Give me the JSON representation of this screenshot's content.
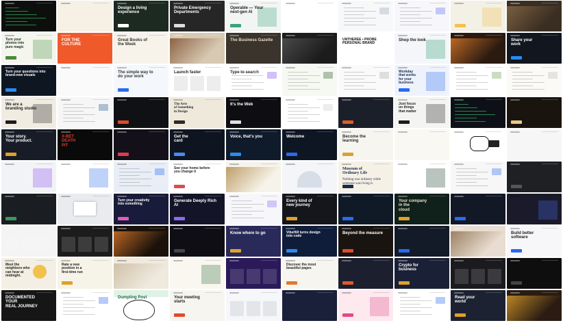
{
  "tiles": [
    {
      "bg": "#0d0f0d",
      "fg": "#3bd16f",
      "t": "",
      "s": "",
      "accent": "#3bd16f",
      "kind": "terminal"
    },
    {
      "bg": "#f6f1e4",
      "fg": "#c49a3a",
      "t": "",
      "s": "",
      "accent": "#d6b46a",
      "kind": "text"
    },
    {
      "bg": "#1c2a22",
      "fg": "#ffffff",
      "t": "Design a living\nexperience",
      "s": "",
      "accent": "#ffffff",
      "kind": "hero"
    },
    {
      "bg": "#262626",
      "fg": "#ffffff",
      "t": "Private Emergency\nDepartments",
      "s": "",
      "accent": "#dddddd",
      "kind": "hero"
    },
    {
      "bg": "#f3f5f4",
      "fg": "#222222",
      "t": "Operable — Your\nnext-gen AI",
      "s": "",
      "accent": "#3aa47a",
      "kind": "split"
    },
    {
      "bg": "#ffffff",
      "fg": "#333333",
      "t": "",
      "s": "",
      "accent": "#e7a8c4",
      "kind": "blobs"
    },
    {
      "bg": "#f7f8fa",
      "fg": "#333333",
      "t": "",
      "s": "",
      "accent": "#9aa3b2",
      "kind": "doc"
    },
    {
      "bg": "#f7f7fb",
      "fg": "#333333",
      "t": "",
      "s": "",
      "accent": "#5b6cf6",
      "kind": "doc"
    },
    {
      "bg": "#f3f0e6",
      "fg": "#222222",
      "t": "",
      "s": "",
      "accent": "#f2c14a",
      "kind": "split"
    },
    {
      "bg": "#3a2e22",
      "fg": "#ffffff",
      "t": "",
      "s": "",
      "accent": "#8a6b4a",
      "kind": "photo"
    },
    {
      "bg": "#f4f6ee",
      "fg": "#1d2a1d",
      "t": "Turn your\nphotos into\npure magic",
      "s": "",
      "accent": "#4a8a3a",
      "kind": "split"
    },
    {
      "bg": "#f05a2a",
      "fg": "#ffffff",
      "t": "FOR THE\nCULTURE",
      "s": "",
      "accent": "#1c1c7a",
      "kind": "poster"
    },
    {
      "bg": "#f7f3ea",
      "fg": "#333333",
      "t": "Great Books of\nthe Week",
      "s": "",
      "accent": "#c47a3a",
      "kind": "text"
    },
    {
      "bg": "#d8c9b2",
      "fg": "#ffffff",
      "t": "",
      "s": "",
      "accent": "#7a4a2a",
      "kind": "photo"
    },
    {
      "bg": "#3a342c",
      "fg": "#e8dcc8",
      "t": "The Business Gazette",
      "s": "",
      "accent": "#e8dcc8",
      "kind": "news"
    },
    {
      "bg": "#1c1c1c",
      "fg": "#eeeeee",
      "t": "",
      "s": "",
      "accent": "#555555",
      "kind": "photo"
    },
    {
      "bg": "#ffffff",
      "fg": "#111111",
      "t": "UNTHEREE • PROBE\nPERSONAL BRAND",
      "s": "",
      "accent": "#111111",
      "kind": "bold"
    },
    {
      "bg": "#f4f6fa",
      "fg": "#222222",
      "t": "Shop the look",
      "s": "",
      "accent": "#2a9a6a",
      "kind": "phone"
    },
    {
      "bg": "#2a1a10",
      "fg": "#ffffff",
      "t": "",
      "s": "",
      "accent": "#e07a2a",
      "kind": "food"
    },
    {
      "bg": "#11161f",
      "fg": "#ffffff",
      "t": "Share your\nwork",
      "s": "",
      "accent": "#2a8af0",
      "kind": "hero"
    },
    {
      "bg": "#0e1622",
      "fg": "#ffffff",
      "t": "Turn your questions into\nbrand-new visuals",
      "s": "",
      "accent": "#2a8af0",
      "kind": "hero"
    },
    {
      "bg": "#fafafa",
      "fg": "#333333",
      "t": "",
      "s": "",
      "accent": "#dddddd",
      "kind": "blank"
    },
    {
      "bg": "#f4f7fb",
      "fg": "#333333",
      "t": "The simple way to\ndo your work",
      "s": "",
      "accent": "#2a6af0",
      "kind": "hero-light"
    },
    {
      "bg": "#ffffff",
      "fg": "#222222",
      "t": "Launch faster",
      "s": "",
      "accent": "#c04a9a",
      "kind": "cards"
    },
    {
      "bg": "#ffffff",
      "fg": "#333333",
      "t": "Type to search",
      "s": "",
      "accent": "#7a4af0",
      "kind": "grid-light"
    },
    {
      "bg": "#f6f8f2",
      "fg": "#2a3a2a",
      "t": "",
      "s": "",
      "accent": "#2a5a2a",
      "kind": "doc"
    },
    {
      "bg": "#fafafa",
      "fg": "#333333",
      "t": "",
      "s": "",
      "accent": "#aaaaaa",
      "kind": "doc"
    },
    {
      "bg": "#eef3fb",
      "fg": "#1a2a4a",
      "t": "Workday\nthat works\nfor your\nbusiness",
      "s": "",
      "accent": "#2a6af0",
      "kind": "split"
    },
    {
      "bg": "#ffffff",
      "fg": "#333333",
      "t": "",
      "s": "",
      "accent": "#6a9a4a",
      "kind": "doc"
    },
    {
      "bg": "#fbfaf6",
      "fg": "#333333",
      "t": "",
      "s": "",
      "accent": "#bbbbbb",
      "kind": "doc"
    },
    {
      "bg": "#f0ece2",
      "fg": "#222222",
      "t": "We are a\nbranding studio",
      "s": "",
      "accent": "#1c1c1c",
      "kind": "split"
    },
    {
      "bg": "#f6f6f6",
      "fg": "#333333",
      "t": "",
      "s": "",
      "accent": "#2a5a8a",
      "kind": "book"
    },
    {
      "bg": "#0f1115",
      "fg": "#ffffff",
      "t": "",
      "s": "",
      "accent": "#e04a2a",
      "kind": "dark"
    },
    {
      "bg": "#efe9dc",
      "fg": "#2a2a2a",
      "t": "The Arte\nof Something\nin Design",
      "s": "",
      "accent": "#2a2a2a",
      "kind": "serif"
    },
    {
      "bg": "#0d0d12",
      "fg": "#ffffff",
      "t": "It's the Web",
      "s": "",
      "accent": "#e0e0e0",
      "kind": "hero"
    },
    {
      "bg": "#ffffff",
      "fg": "#333333",
      "t": "",
      "s": "",
      "accent": "#cccccc",
      "kind": "flow"
    },
    {
      "bg": "#1b1f2a",
      "fg": "#ffffff",
      "t": "",
      "s": "",
      "accent": "#e05a2a",
      "kind": "dark"
    },
    {
      "bg": "#f4f4f2",
      "fg": "#222222",
      "t": "Just focus\non things\nthat matter",
      "s": "",
      "accent": "#1c1c1c",
      "kind": "split"
    },
    {
      "bg": "#0d1117",
      "fg": "#3bd16f",
      "t": "",
      "s": "",
      "accent": "#3bd16f",
      "kind": "terminal"
    },
    {
      "bg": "#1a140e",
      "fg": "#e8c88a",
      "t": "",
      "s": "",
      "accent": "#e8c88a",
      "kind": "dark"
    },
    {
      "bg": "#171c26",
      "fg": "#ffffff",
      "t": "Your story.\nYour product.",
      "s": "",
      "accent": "#e0a02a",
      "kind": "hero"
    },
    {
      "bg": "#0a0a0a",
      "fg": "#e03a2a",
      "t": "X-BET\nDEATH\nPIT",
      "s": "",
      "accent": "#e03a2a",
      "kind": "bold"
    },
    {
      "bg": "#14101a",
      "fg": "#e0e0e0",
      "t": "",
      "s": "",
      "accent": "#e03a4a",
      "kind": "dark"
    },
    {
      "bg": "#0f1520",
      "fg": "#ffffff",
      "t": "Get the\ncard",
      "s": "",
      "accent": "#4a8af0",
      "kind": "hero"
    },
    {
      "bg": "#0f1a2a",
      "fg": "#ffffff",
      "t": "Voice, that's you",
      "s": "",
      "accent": "#2a8af0",
      "kind": "hero"
    },
    {
      "bg": "#0e1624",
      "fg": "#ffffff",
      "t": "Welcome",
      "s": "",
      "accent": "#2a6af0",
      "kind": "hero"
    },
    {
      "bg": "#f7f5ef",
      "fg": "#2a2a2a",
      "t": "Become the\nlearning",
      "s": "",
      "accent": "#d8a03a",
      "kind": "center"
    },
    {
      "bg": "#faf8f2",
      "fg": "#333333",
      "t": "",
      "s": "",
      "accent": "#dddddd",
      "kind": "blank"
    },
    {
      "bg": "#ffffff",
      "fg": "#111111",
      "t": "",
      "s": "",
      "accent": "#111111",
      "kind": "mascot"
    },
    {
      "bg": "#f6f6f6",
      "fg": "#333333",
      "t": "",
      "s": "",
      "accent": "#e07a2a",
      "kind": "blank"
    },
    {
      "bg": "#f1f3f7",
      "fg": "#333333",
      "t": "",
      "s": "",
      "accent": "#8a4af0",
      "kind": "card"
    },
    {
      "bg": "#ffffff",
      "fg": "#333333",
      "t": "",
      "s": "",
      "accent": "#2a6af0",
      "kind": "card"
    },
    {
      "bg": "#e9eef6",
      "fg": "#222222",
      "t": "",
      "s": "",
      "accent": "#2a6af0",
      "kind": "doc"
    },
    {
      "bg": "#ffffff",
      "fg": "#222222",
      "t": "See your home before\nyou change it",
      "s": "",
      "accent": "#e04a4a",
      "kind": "hero-light"
    },
    {
      "bg": "#f6f3ea",
      "fg": "#222222",
      "t": "",
      "s": "",
      "accent": "#b08a4a",
      "kind": "landscape"
    },
    {
      "bg": "#f3f5f8",
      "fg": "#1a2a4a",
      "t": "",
      "s": "",
      "accent": "#2a4a8a",
      "kind": "capitol"
    },
    {
      "bg": "#f6f1e6",
      "fg": "#1a2a4a",
      "t": "Museum of\nOrdinary Life",
      "s": "Nothing was\nordinary\nwhile someone\nwas living it.",
      "accent": "#1a2a4a",
      "kind": "serif"
    },
    {
      "bg": "#ffffff",
      "fg": "#1a3a2a",
      "t": "",
      "s": "",
      "accent": "#1a3a2a",
      "kind": "green"
    },
    {
      "bg": "#f7f7f7",
      "fg": "#333333",
      "t": "",
      "s": "",
      "accent": "#2a6af0",
      "kind": "doc"
    },
    {
      "bg": "#1e2024",
      "fg": "#dddddd",
      "t": "",
      "s": "",
      "accent": "#555555",
      "kind": "dark"
    },
    {
      "bg": "#1a1d22",
      "fg": "#dddddd",
      "t": "",
      "s": "",
      "accent": "#3a9a5a",
      "kind": "dark"
    },
    {
      "bg": "#e9ebee",
      "fg": "#333333",
      "t": "",
      "s": "",
      "accent": "#bbbbbb",
      "kind": "modal"
    },
    {
      "bg": "#181c3a",
      "fg": "#ffffff",
      "t": "Turn your creativity\ninto something",
      "s": "",
      "accent": "#e05ac0",
      "kind": "hero"
    },
    {
      "bg": "#141428",
      "fg": "#ffffff",
      "t": "Generate Deeply Rich AI",
      "s": "",
      "accent": "#8a6af0",
      "kind": "hero"
    },
    {
      "bg": "#f7f7fb",
      "fg": "#333333",
      "t": "",
      "s": "",
      "accent": "#8a6af0",
      "kind": "doc"
    },
    {
      "bg": "#14161c",
      "fg": "#ffffff",
      "t": "Every kind of\nnew journey",
      "s": "",
      "accent": "#e0a02a",
      "kind": "dark"
    },
    {
      "bg": "#0f1a26",
      "fg": "#ffffff",
      "t": "",
      "s": "",
      "accent": "#2a6af0",
      "kind": "dark"
    },
    {
      "bg": "#10201a",
      "fg": "#e8e0c8",
      "t": "Your company\nin the\ncloud",
      "s": "",
      "accent": "#e0a02a",
      "kind": "hero"
    },
    {
      "bg": "#121826",
      "fg": "#ffffff",
      "t": "",
      "s": "",
      "accent": "#2a6af0",
      "kind": "dark"
    },
    {
      "bg": "#1a1a2a",
      "fg": "#ffffff",
      "t": "",
      "s": "",
      "accent": "#4a6af0",
      "kind": "card"
    },
    {
      "bg": "#f4f4f4",
      "fg": "#222222",
      "t": "",
      "s": "",
      "accent": "#2a4a8a",
      "kind": "gallery"
    },
    {
      "bg": "#1c1c1c",
      "fg": "#ffffff",
      "t": "",
      "s": "",
      "accent": "#888888",
      "kind": "gallery"
    },
    {
      "bg": "#1a120a",
      "fg": "#ffffff",
      "t": "",
      "s": "",
      "accent": "#e07a2a",
      "kind": "food"
    },
    {
      "bg": "#0e0e14",
      "fg": "#ffffff",
      "t": "",
      "s": "",
      "accent": "#444444",
      "kind": "dark"
    },
    {
      "bg": "#2a2a5a",
      "fg": "#ffffff",
      "t": "Know where to go",
      "s": "",
      "accent": "#e0a02a",
      "kind": "hero"
    },
    {
      "bg": "#0f1c3a",
      "fg": "#ffffff",
      "t": "VibeHill turns design\ninto code",
      "s": "",
      "accent": "#2a8af0",
      "kind": "hero"
    },
    {
      "bg": "#1a1410",
      "fg": "#ffffff",
      "t": "Beyond the measure",
      "s": "",
      "accent": "#e04a2a",
      "kind": "hero"
    },
    {
      "bg": "#131a28",
      "fg": "#ffffff",
      "t": "",
      "s": "",
      "accent": "#2a6af0",
      "kind": "dark"
    },
    {
      "bg": "#e8ddd0",
      "fg": "#222222",
      "t": "",
      "s": "",
      "accent": "#8a6a4a",
      "kind": "sky"
    },
    {
      "bg": "#f7f7fa",
      "fg": "#222222",
      "t": "Build better\nsoftware",
      "s": "",
      "accent": "#2a6af0",
      "kind": "hero-light"
    },
    {
      "bg": "#f3efe4",
      "fg": "#222222",
      "t": "Meet the\nneighbors who\ncan hear at\nmidnight.",
      "s": "",
      "accent": "#f2c14a",
      "kind": "moon"
    },
    {
      "bg": "#f6f3e8",
      "fg": "#222222",
      "t": "Rate a new\nposition in a\nfirst-time run",
      "s": "",
      "accent": "#e0a02a",
      "kind": "hero-light"
    },
    {
      "bg": "#efe9de",
      "fg": "#333333",
      "t": "",
      "s": "",
      "accent": "#c8b89a",
      "kind": "interior"
    },
    {
      "bg": "#faf7f0",
      "fg": "#2a4a2a",
      "t": "",
      "s": "",
      "accent": "#2a6a3a",
      "kind": "tree"
    },
    {
      "bg": "#2a1a5a",
      "fg": "#ffffff",
      "t": "",
      "s": "",
      "accent": "#8a6af0",
      "kind": "pricing"
    },
    {
      "bg": "#f7f5ef",
      "fg": "#222222",
      "t": "Discover the most\nbeautiful pages",
      "s": "",
      "accent": "#e07a2a",
      "kind": "hero-light"
    },
    {
      "bg": "#1b1f2e",
      "fg": "#ffffff",
      "t": "",
      "s": "",
      "accent": "#e05a2a",
      "kind": "dark"
    },
    {
      "bg": "#1a2036",
      "fg": "#ffffff",
      "t": "Crypto for\nbusiness",
      "s": "",
      "accent": "#e0a02a",
      "kind": "hero"
    },
    {
      "bg": "#1b1b1f",
      "fg": "#ffffff",
      "t": "",
      "s": "",
      "accent": "#2a6af0",
      "kind": "gallery"
    },
    {
      "bg": "#0e0e0e",
      "fg": "#dddddd",
      "t": "",
      "s": "",
      "accent": "#444444",
      "kind": "dark"
    },
    {
      "bg": "#161616",
      "fg": "#ffffff",
      "t": "DOCUMENTED\nYOUR\nREAL JOURNEY",
      "s": "",
      "accent": "#e0a02a",
      "kind": "bold"
    },
    {
      "bg": "#ffffff",
      "fg": "#222222",
      "t": "",
      "s": "",
      "accent": "#2a6af0",
      "kind": "doc"
    },
    {
      "bg": "#ffffff",
      "fg": "#1a6a3a",
      "t": "Dumpling Post",
      "s": "",
      "accent": "#1a6a3a",
      "kind": "dumpling"
    },
    {
      "bg": "#f7f5ef",
      "fg": "#222222",
      "t": "Your meeting\nstarts",
      "s": "",
      "accent": "#e04a2a",
      "kind": "hero-light"
    },
    {
      "bg": "#f6f7fb",
      "fg": "#333333",
      "t": "",
      "s": "",
      "accent": "#2a6af0",
      "kind": "cards"
    },
    {
      "bg": "#1a1f3a",
      "fg": "#ffffff",
      "t": "",
      "s": "",
      "accent": "#e0e0e0",
      "kind": "poster2"
    },
    {
      "bg": "#fde9ee",
      "fg": "#222222",
      "t": "",
      "s": "",
      "accent": "#e04a8a",
      "kind": "split"
    },
    {
      "bg": "#ffffff",
      "fg": "#222222",
      "t": "",
      "s": "",
      "accent": "#2a6af0",
      "kind": "doc"
    },
    {
      "bg": "#1c2232",
      "fg": "#ffffff",
      "t": "Read your\nworld",
      "s": "",
      "accent": "#e0a02a",
      "kind": "hero"
    },
    {
      "bg": "#2a1c12",
      "fg": "#ffffff",
      "t": "",
      "s": "",
      "accent": "#e0a02a",
      "kind": "photo"
    },
    {
      "bg": "#131a28",
      "fg": "#ffffff",
      "t": "",
      "s": "",
      "accent": "#2a6af0",
      "kind": "dark"
    },
    {
      "bg": "#fafafa",
      "fg": "#333333",
      "t": "",
      "s": "",
      "accent": "#999999",
      "kind": "logos"
    }
  ]
}
